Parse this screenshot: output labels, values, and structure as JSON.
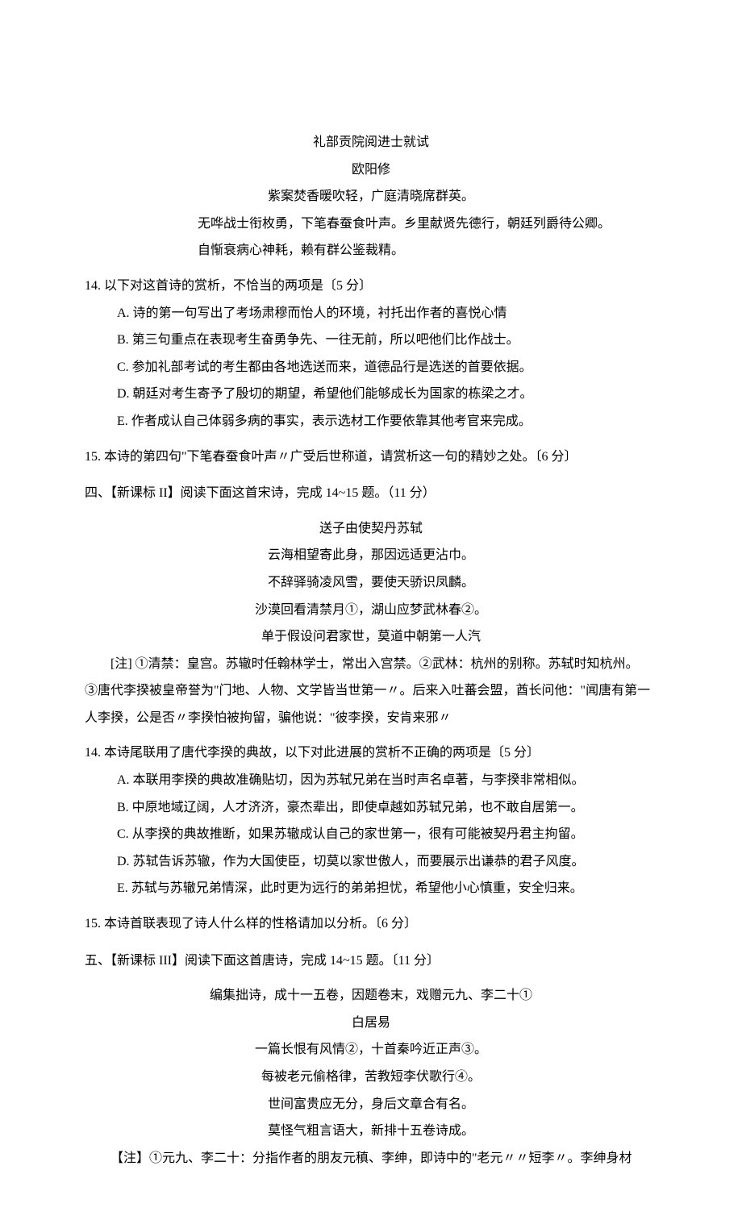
{
  "poem1": {
    "title": "礼部贡院阅进士就试",
    "author": "欧阳修",
    "lines": [
      "紫案焚香暖吹轻，广庭清晓席群英。",
      "无哗战士衔枚勇，下笔春蚕食叶声。乡里献贤先德行，朝廷列爵待公卿。自惭衰病心神耗，赖有群公鉴裁精。"
    ]
  },
  "q14a": {
    "stem": "14. 以下对这首诗的赏析，不恰当的两项是〔5 分〕",
    "opts": [
      "A. 诗的第一句写出了考场肃穆而怡人的环境，衬托出作者的喜悦心情",
      "B. 第三句重点在表现考生奋勇争先、一往无前，所以吧他们比作战士。",
      "C. 参加礼部考试的考生都由各地选送而来，道德品行是选送的首要依据。",
      "D. 朝廷对考生寄予了殷切的期望，希望他们能够成长为国家的栋梁之才。",
      "E. 作者成认自己体弱多病的事实，表示选材工作要依靠其他考官来完成。"
    ]
  },
  "q15a": "15. 本诗的第四句\"下笔春蚕食叶声〃广受后世称道，请赏析这一句的精妙之处。〔6 分〕",
  "section2": "四、【新课标 II】阅读下面这首宋诗，完成 14~15 题。（11 分）",
  "poem2": {
    "title": "送子由使契丹苏轼",
    "lines": [
      "云海相望寄此身，那因远适更沾巾。",
      "不辞驿骑凌风雪，要使天骄识凤麟。",
      "沙漠回看清禁月①，湖山应梦武林春②。",
      "单于假设问君家世，莫道中朝第一人汽"
    ]
  },
  "note2_lines": [
    "[注] ①清禁：皇宫。苏辙时任翰林学士，常出入宫禁。②武林：杭州的别称。苏轼时知杭州。",
    "③唐代李揆被皇帝誉为\"门地、人物、文学皆当世第一〃。后来入吐蕃会盟，酋长问他：\"闻唐有第一人李揆，公是否〃李揆怕被拘留，骗他说：\"彼李揆，安肯来邪〃"
  ],
  "q14b": {
    "stem": "14. 本诗尾联用了唐代李揆的典故，以下对此进展的赏析不正确的两项是〔5 分〕",
    "opts": [
      "A. 本联用李揆的典故准确贴切，因为苏轼兄弟在当时声名卓著，与李揆非常相似。",
      "B. 中原地域辽阔，人才济济，豪杰辈出，即使卓越如苏轼兄弟，也不敢自居第一。",
      "C. 从李揆的典故推断，如果苏辙成认自己的家世第一，很有可能被契丹君主拘留。",
      "D. 苏轼告诉苏辙，作为大国使臣，切莫以家世傲人，而要展示出谦恭的君子风度。",
      "E. 苏轼与苏辙兄弟情深，此时更为远行的弟弟担忧，希望他小心慎重，安全归来。"
    ]
  },
  "q15b": "15. 本诗首联表现了诗人什么样的性格请加以分析。〔6 分〕",
  "section3": "五、【新课标 III】阅读下面这首唐诗，完成 14~15 题。〔11 分〕",
  "poem3": {
    "title": "编集拙诗，成十一五卷，因题卷末，戏赠元九、李二十①",
    "author": "白居易",
    "lines": [
      "一篇长恨有风情②，十首秦吟近正声③。",
      "每被老元偷格律，苦教短李伏歌行④。",
      "世间富贵应无分，身后文章合有名。",
      "莫怪气粗言语大，新排十五卷诗成。"
    ]
  },
  "note3": "【注】①元九、李二十：分指作者的朋友元稹、李绅，即诗中的\"老元〃〃短李〃。李绅身材"
}
